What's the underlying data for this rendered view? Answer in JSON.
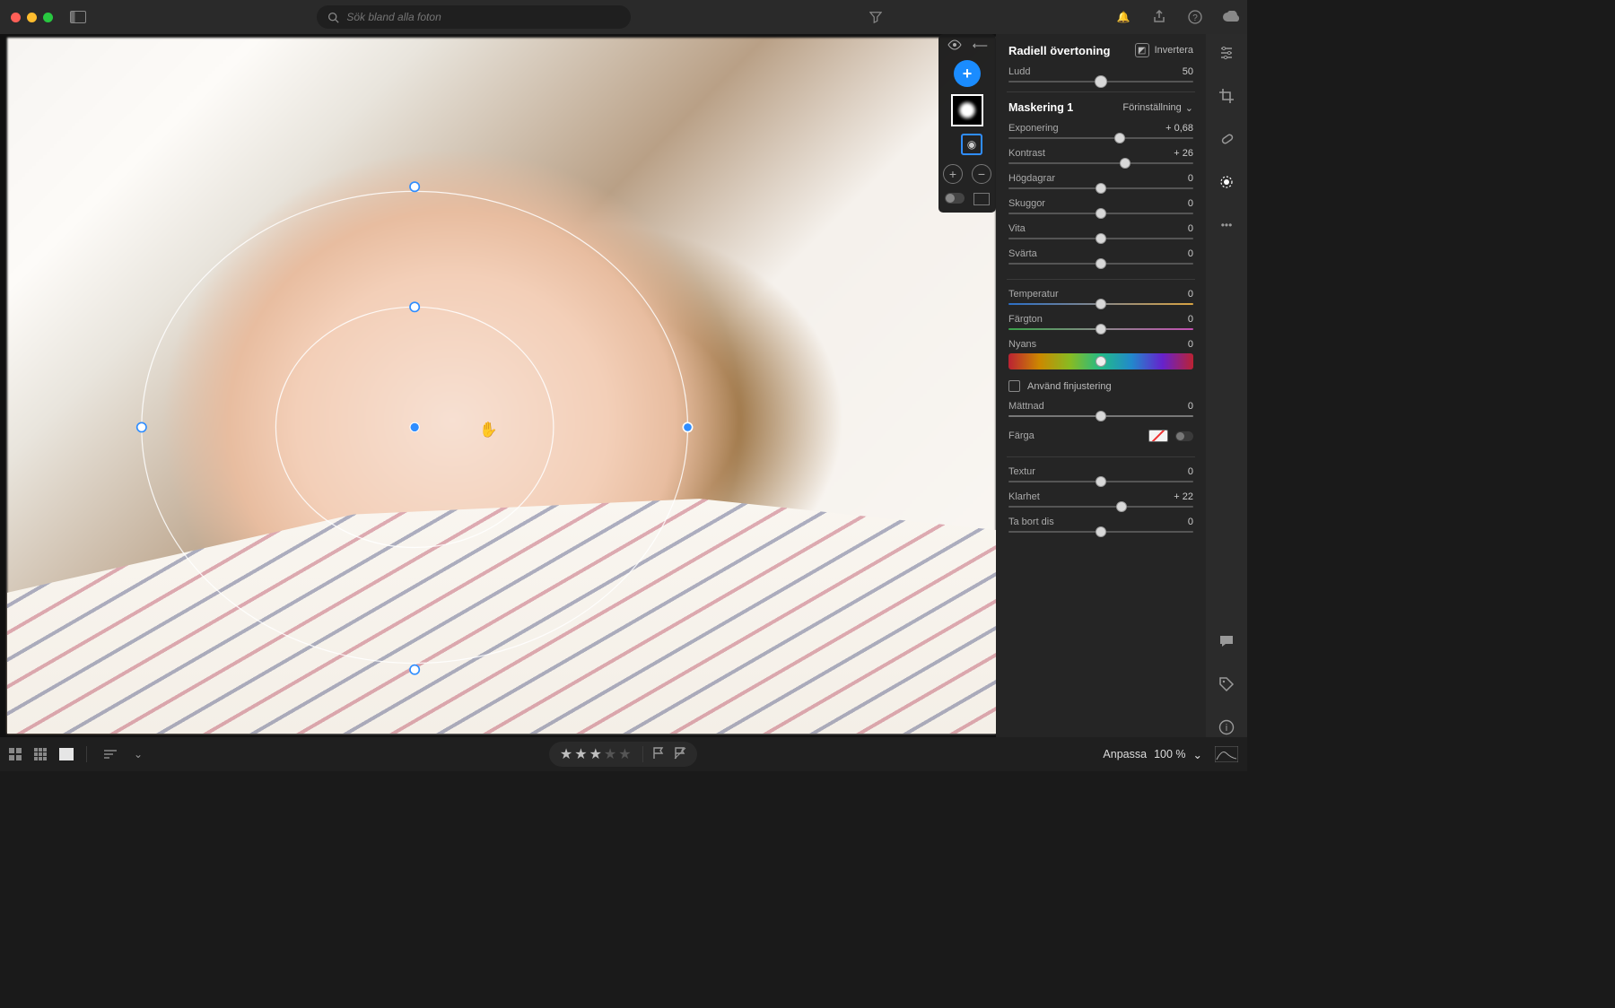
{
  "search": {
    "placeholder": "Sök bland alla foton"
  },
  "panel": {
    "title": "Radiell övertoning",
    "invert_label": "Invertera",
    "feather": {
      "label": "Ludd",
      "value": "50",
      "pct": 50
    },
    "mask_name": "Maskering 1",
    "preset_label": "Förinställning",
    "sliders": {
      "exposure": {
        "label": "Exponering",
        "value": "+ 0,68",
        "pct": 60
      },
      "contrast": {
        "label": "Kontrast",
        "value": "+ 26",
        "pct": 63
      },
      "highlights": {
        "label": "Högdagrar",
        "value": "0",
        "pct": 50
      },
      "shadows": {
        "label": "Skuggor",
        "value": "0",
        "pct": 50
      },
      "whites": {
        "label": "Vita",
        "value": "0",
        "pct": 50
      },
      "blacks": {
        "label": "Svärta",
        "value": "0",
        "pct": 50
      },
      "temp": {
        "label": "Temperatur",
        "value": "0",
        "pct": 50
      },
      "tint": {
        "label": "Färgton",
        "value": "0",
        "pct": 50
      },
      "hue": {
        "label": "Nyans",
        "value": "0",
        "pct": 50
      },
      "saturation": {
        "label": "Mättnad",
        "value": "0",
        "pct": 50
      },
      "texture": {
        "label": "Textur",
        "value": "0",
        "pct": 50
      },
      "clarity": {
        "label": "Klarhet",
        "value": "+ 22",
        "pct": 61
      },
      "dehaze": {
        "label": "Ta bort dis",
        "value": "0",
        "pct": 50
      }
    },
    "fine_adjust_label": "Använd finjustering",
    "color_label": "Färga"
  },
  "bottom": {
    "fit_label": "Anpassa",
    "zoom_value": "100 %",
    "stars_filled": 3,
    "stars_total": 5
  }
}
